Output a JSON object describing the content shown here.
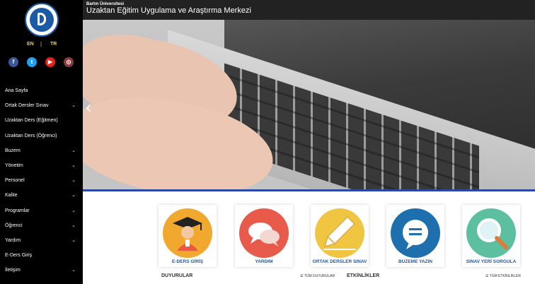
{
  "header": {
    "subtitle": "Bartın Üniversitesi",
    "title": "Uzaktan Eğitim Uygulama ve Araştırma Merkezi"
  },
  "sidebar": {
    "lang_en": "EN",
    "lang_sep": "|",
    "lang_tr": "TR",
    "social": [
      {
        "icon": "facebook-icon",
        "glyph": "f",
        "color": "#3b5998"
      },
      {
        "icon": "twitter-icon",
        "glyph": "t",
        "color": "#1da1f2"
      },
      {
        "icon": "youtube-icon",
        "glyph": "▶",
        "color": "#e62117"
      },
      {
        "icon": "instagram-icon",
        "glyph": "◎",
        "color": "#8a3a3a"
      }
    ],
    "menu": [
      {
        "label": "Ana Sayfa",
        "chevron": ""
      },
      {
        "label": "Ortak Dersler Sınav",
        "chevron": "⌄"
      },
      {
        "label": "Uzaktan Ders (Eğitmen)",
        "chevron": ""
      },
      {
        "label": "Uzaktan Ders (Öğrenci)",
        "chevron": ""
      },
      {
        "label": "Buzem",
        "chevron": "⌄"
      },
      {
        "label": "Yönetim",
        "chevron": "⌄"
      },
      {
        "label": "Personel",
        "chevron": "⌄"
      },
      {
        "label": "Kalite",
        "chevron": "⌄"
      },
      {
        "label": "Programlar",
        "chevron": "⌄"
      },
      {
        "label": "Öğrenci",
        "chevron": "⌄"
      },
      {
        "label": "Yardım",
        "chevron": "⌄"
      },
      {
        "label": "E-Ders Giriş",
        "chevron": ""
      },
      {
        "label": "İletişim",
        "chevron": "⌄"
      }
    ]
  },
  "slider": {
    "prev": "‹"
  },
  "cards": [
    {
      "label": "E-DERS GİRİŞ",
      "color": "#f0a92e",
      "icon": "graduate-icon"
    },
    {
      "label": "YARDIM",
      "color": "#e85a4a",
      "icon": "chat-bubbles-icon"
    },
    {
      "label": "ORTAK DERSLER SINAV",
      "color": "#f0c542",
      "icon": "pencil-icon"
    },
    {
      "label": "BUZEME YAZIN",
      "color": "#1e6fae",
      "icon": "message-icon"
    },
    {
      "label": "SINAV YERİ SORGULA",
      "color": "#5cc0a0",
      "icon": "magnifier-icon"
    }
  ],
  "sections": {
    "announcements": "DUYURULAR",
    "announcements_link": "☰ TÜM DUYURULAR",
    "events": "ETKİNLİKLER",
    "events_link": "☰ TÜM ETKİNLİKLER"
  }
}
